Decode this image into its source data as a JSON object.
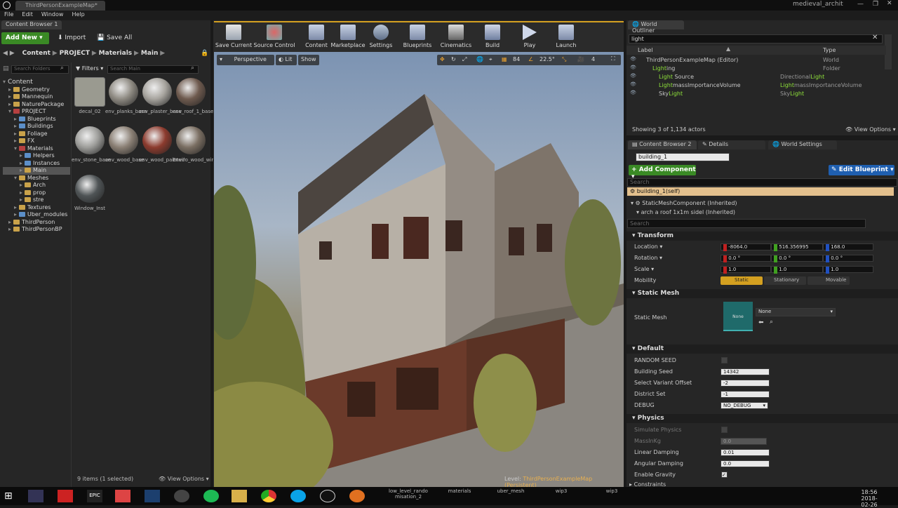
{
  "titlebar": {
    "tab": "ThirdPersonExampleMap*",
    "project": "medieval_archit"
  },
  "menu": [
    "File",
    "Edit",
    "Window",
    "Help"
  ],
  "content_browser": {
    "tab": "Content Browser 1",
    "add_new": "Add New",
    "import": "Import",
    "save_all": "Save All",
    "breadcrumb": [
      "Content",
      "PROJECT",
      "Materials",
      "Main"
    ],
    "search_folders": "Search Folders",
    "filters": "Filters",
    "search_main": "Search Main",
    "tree": [
      {
        "label": "Content",
        "indent": 0,
        "open": true,
        "kind": "root"
      },
      {
        "label": "Geometry",
        "indent": 1,
        "kind": "y"
      },
      {
        "label": "Mannequin",
        "indent": 1,
        "kind": "y"
      },
      {
        "label": "NaturePackage",
        "indent": 1,
        "kind": "y"
      },
      {
        "label": "PROJECT",
        "indent": 1,
        "open": true,
        "kind": "r"
      },
      {
        "label": "Blueprints",
        "indent": 2,
        "kind": "b"
      },
      {
        "label": "Buildings",
        "indent": 2,
        "kind": "b"
      },
      {
        "label": "Foliage",
        "indent": 2,
        "kind": "y"
      },
      {
        "label": "FX",
        "indent": 2,
        "kind": "y"
      },
      {
        "label": "Materials",
        "indent": 2,
        "open": true,
        "kind": "r"
      },
      {
        "label": "Helpers",
        "indent": 3,
        "kind": "b"
      },
      {
        "label": "Instances",
        "indent": 3,
        "kind": "b"
      },
      {
        "label": "Main",
        "indent": 3,
        "kind": "y",
        "selected": true
      },
      {
        "label": "Meshes",
        "indent": 2,
        "open": true,
        "kind": "y"
      },
      {
        "label": "Arch",
        "indent": 3,
        "kind": "y"
      },
      {
        "label": "prop",
        "indent": 3,
        "kind": "y"
      },
      {
        "label": "stre",
        "indent": 3,
        "kind": "y"
      },
      {
        "label": "Textures",
        "indent": 2,
        "kind": "y"
      },
      {
        "label": "Uber_modules",
        "indent": 2,
        "kind": "b"
      },
      {
        "label": "ThirdPerson",
        "indent": 1,
        "kind": "y"
      },
      {
        "label": "ThirdPersonBP",
        "indent": 1,
        "kind": "y"
      }
    ],
    "assets": [
      {
        "label": "decal_02",
        "color": "#9a9a90"
      },
      {
        "label": "env_planks_base",
        "color": "#8e8a82"
      },
      {
        "label": "env_plaster_base",
        "color": "#a7a49e"
      },
      {
        "label": "env_roof_1_base",
        "color": "#6e5a4e"
      },
      {
        "label": "env_stone_base",
        "color": "#9d9d9a"
      },
      {
        "label": "env_wood_base",
        "color": "#8a7f74"
      },
      {
        "label": "env_wood_painted",
        "color": "#8c3b2e"
      },
      {
        "label": "Enviro_wood_window",
        "color": "#7a6e62"
      },
      {
        "label": "Window_Inst",
        "color": "#4f5456"
      }
    ],
    "status": "9 items (1 selected)",
    "view_options": "View Options"
  },
  "viewport": {
    "toolbar": [
      "Save Current",
      "Source Control",
      "Content",
      "Marketplace",
      "Settings",
      "Blueprints",
      "Cinematics",
      "Build",
      "Play",
      "Launch"
    ],
    "perspective": "Perspective",
    "lit": "Lit",
    "show": "Show",
    "snap_grid": "84",
    "snap_angle": "22.5°",
    "cam_speed": "4",
    "level": "Level:",
    "level_name": "ThirdPersonExampleMap (Persistent)"
  },
  "world_outliner": {
    "tab": "World Outliner",
    "search": "light",
    "col_label": "Label",
    "col_type": "Type",
    "rows": [
      {
        "label": "ThirdPersonExampleMap (Editor)",
        "type": "World",
        "indent": 0
      },
      {
        "label": "Lighting",
        "type": "Folder",
        "indent": 1
      },
      {
        "label": "Light Source",
        "type": "DirectionalLight",
        "indent": 2
      },
      {
        "label": "LightmassImportanceVolume",
        "type": "LightmassImportanceVolume",
        "indent": 2
      },
      {
        "label": "SkyLight",
        "type": "SkyLight",
        "indent": 2
      }
    ],
    "status": "Showing 3 of 1,134 actors",
    "view_options": "View Options"
  },
  "details": {
    "tabs": [
      "Content Browser 2",
      "Details",
      "World Settings"
    ],
    "actor_name": "building_1",
    "add_component": "Add Component",
    "edit_blueprint": "Edit Blueprint",
    "search": "Search",
    "self": "building_1(self)",
    "components": [
      "StaticMeshComponent (Inherited)",
      "arch a roof 1x1m sidel (Inherited)"
    ],
    "search2": "Search",
    "transform": {
      "title": "Transform",
      "location": {
        "label": "Location",
        "x": "-8064.0",
        "y": "516.356995",
        "z": "168.0"
      },
      "rotation": {
        "label": "Rotation",
        "x": "0.0 °",
        "y": "0.0 °",
        "z": "0.0 °"
      },
      "scale": {
        "label": "Scale",
        "x": "1.0",
        "y": "1.0",
        "z": "1.0"
      },
      "mobility": {
        "label": "Mobility",
        "opts": [
          "Static",
          "Stationary",
          "Movable"
        ]
      }
    },
    "static_mesh": {
      "title": "Static Mesh",
      "label": "Static Mesh",
      "thumb": "None",
      "value": "None"
    },
    "default": {
      "title": "Default",
      "random_seed": "RANDOM SEED",
      "building_seed": "Building Seed",
      "building_seed_val": "14342",
      "variant": "Select Variant Offset",
      "variant_val": "-2",
      "district": "District Set",
      "district_val": "-1",
      "debug": "DEBUG",
      "debug_val": "NO_DEBUG"
    },
    "physics": {
      "title": "Physics",
      "simulate": "Simulate Physics",
      "mass": "MassInKg",
      "mass_val": "0.0",
      "linear": "Linear Damping",
      "linear_val": "0.01",
      "angular": "Angular Damping",
      "angular_val": "0.0",
      "gravity": "Enable Gravity",
      "constraints": "Constraints"
    }
  },
  "taskbar": {
    "items": [
      "low_level_rando misation_2",
      "materials",
      "uber_mesh",
      "wip3",
      "wip3"
    ],
    "time": "18:56",
    "date": "2018-02-26"
  }
}
